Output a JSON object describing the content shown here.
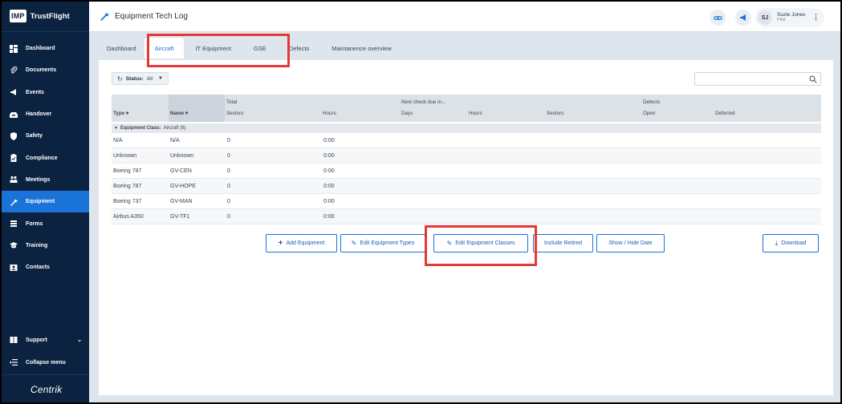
{
  "brand": {
    "logo": "IMP",
    "name": "TrustFlight"
  },
  "nav": [
    {
      "label": "Dashboard",
      "icon": "dashboard-icon",
      "active": false
    },
    {
      "label": "Documents",
      "icon": "paperclip-icon",
      "active": false
    },
    {
      "label": "Events",
      "icon": "megaphone-icon",
      "active": false
    },
    {
      "label": "Handover",
      "icon": "tray-icon",
      "active": false
    },
    {
      "label": "Safety",
      "icon": "shield-icon",
      "active": false
    },
    {
      "label": "Compliance",
      "icon": "clipboard-icon",
      "active": false
    },
    {
      "label": "Meetings",
      "icon": "people-icon",
      "active": false
    },
    {
      "label": "Equipment",
      "icon": "wrench-icon",
      "active": true
    },
    {
      "label": "Forms",
      "icon": "forms-icon",
      "active": false
    },
    {
      "label": "Training",
      "icon": "graduation-cap-icon",
      "active": false
    },
    {
      "label": "Contacts",
      "icon": "contact-card-icon",
      "active": false
    }
  ],
  "sidebar_bottom": {
    "support": "Support",
    "collapse": "Collapse menu",
    "footer_logo": "Centrik"
  },
  "header": {
    "title": "Equipment Tech Log",
    "user_initials": "SJ",
    "user_name": "Suzie Jones",
    "user_role": "Pilot"
  },
  "tabs": [
    {
      "label": "Dashboard",
      "active": false
    },
    {
      "label": "Aircraft",
      "active": true
    },
    {
      "label": "IT Equipment",
      "active": false
    },
    {
      "label": "GSE",
      "active": false
    },
    {
      "label": "Defects",
      "active": false
    },
    {
      "label": "Maintanence overview",
      "active": false
    }
  ],
  "filter": {
    "label": "Status:",
    "value": "All"
  },
  "search": {
    "placeholder": ""
  },
  "table": {
    "headers": {
      "total": "Total",
      "next_check": "Next check due in...",
      "defects": "Defects",
      "type": "Type",
      "name": "Name",
      "sectors": "Sectors",
      "hours": "Hours",
      "days": "Days",
      "hours2": "Hours",
      "sectors2": "Sectors",
      "open": "Open",
      "deferred": "Deferred"
    },
    "group": {
      "label": "Equipment Class:",
      "value": "Aircraft (6)"
    },
    "rows": [
      {
        "type": "N/A",
        "name": "N/A",
        "sectors": "0",
        "hours": "0:00"
      },
      {
        "type": "Unknown",
        "name": "Unknown",
        "sectors": "0",
        "hours": "0:00"
      },
      {
        "type": "Boeing 787",
        "name": "GV-CEN",
        "sectors": "0",
        "hours": "0:00"
      },
      {
        "type": "Boeing 787",
        "name": "GV-HOPE",
        "sectors": "0",
        "hours": "0:00"
      },
      {
        "type": "Boeing 737",
        "name": "GV-MAN",
        "sectors": "0",
        "hours": "0:00"
      },
      {
        "type": "Airbus A350",
        "name": "GV-TF1",
        "sectors": "0",
        "hours": "0:00"
      }
    ]
  },
  "actions": {
    "add_equipment": "Add Equipment",
    "edit_types": "Edit Equipment Types",
    "edit_classes": "Edit Equipment Classes",
    "include_retired": "Include Retired",
    "show_hide_date": "Show / Hide Date",
    "download": "Download"
  },
  "colors": {
    "sidebar": "#0b2240",
    "accent": "#1a73d8",
    "highlight": "#e53935"
  }
}
